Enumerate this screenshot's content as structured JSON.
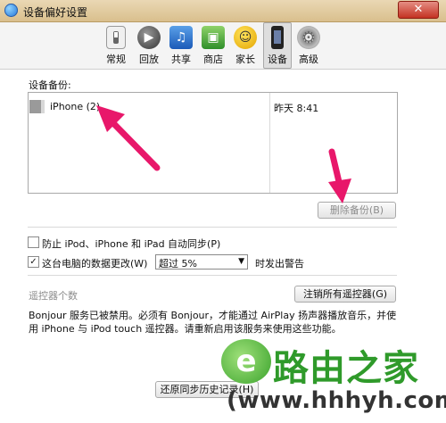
{
  "window": {
    "title": "设备偏好设置",
    "close_glyph": "✕"
  },
  "toolbar": {
    "tabs": [
      {
        "label": "常规",
        "icon": "switch-icon"
      },
      {
        "label": "回放",
        "icon": "play-icon"
      },
      {
        "label": "共享",
        "icon": "music-icon"
      },
      {
        "label": "商店",
        "icon": "store-bag-icon"
      },
      {
        "label": "家长",
        "icon": "parental-icon"
      },
      {
        "label": "设备",
        "icon": "iphone-icon",
        "selected": true
      },
      {
        "label": "高级",
        "icon": "gear-icon"
      }
    ]
  },
  "backups": {
    "label": "设备备份:",
    "rows": [
      {
        "device": "iPhone (2)",
        "time": "昨天 8:41"
      }
    ],
    "delete_button": "删除备份(B)"
  },
  "options": {
    "prevent_sync": {
      "label": "防止 iPod、iPhone 和 iPad 自动同步(P)",
      "checked": false
    },
    "warn_change": {
      "label": "这台电脑的数据更改(W)",
      "checked": true,
      "check_glyph": "✓"
    },
    "warn_threshold": {
      "value": "超过 5%",
      "caret": "▼"
    },
    "warn_suffix": "时发出警告"
  },
  "remotes": {
    "label": "遥控器个数",
    "forget_button": "注销所有遥控器(G)",
    "notice": "Bonjour 服务已被禁用。必须有 Bonjour，才能通过 AirPlay 扬声器播放音乐，并使用 iPhone 与 iPod touch 遥控器。请重新启用该服务来使用这些功能。"
  },
  "footer": {
    "restore_button": "还原同步历史记录(H)"
  },
  "watermark": {
    "logo_glyph": "e",
    "name": "路由之家",
    "url": "(www.hhhyh.com)"
  },
  "colors": {
    "arrow": "#e8176a",
    "watermark_green": "#2f9a2a"
  }
}
